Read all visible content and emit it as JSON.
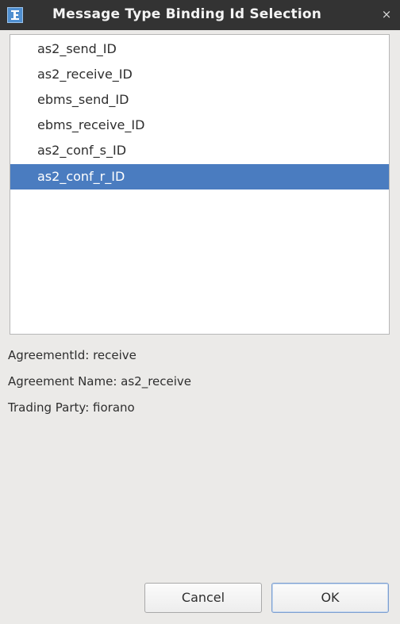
{
  "window": {
    "title": "Message Type Binding Id Selection",
    "close_glyph": "×",
    "app_icon": "fiorano-app-icon"
  },
  "list": {
    "items": [
      {
        "label": "as2_send_ID",
        "selected": false
      },
      {
        "label": "as2_receive_ID",
        "selected": false
      },
      {
        "label": "ebms_send_ID",
        "selected": false
      },
      {
        "label": "ebms_receive_ID",
        "selected": false
      },
      {
        "label": "as2_conf_s_ID",
        "selected": false
      },
      {
        "label": "as2_conf_r_ID",
        "selected": true
      }
    ],
    "selection_color": "#4a7cc0"
  },
  "details": {
    "agreement_id": "AgreementId: receive",
    "agreement_name": "Agreement Name: as2_receive",
    "trading_party": "Trading Party: fiorano"
  },
  "buttons": {
    "cancel_label": "Cancel",
    "ok_label": "OK"
  }
}
